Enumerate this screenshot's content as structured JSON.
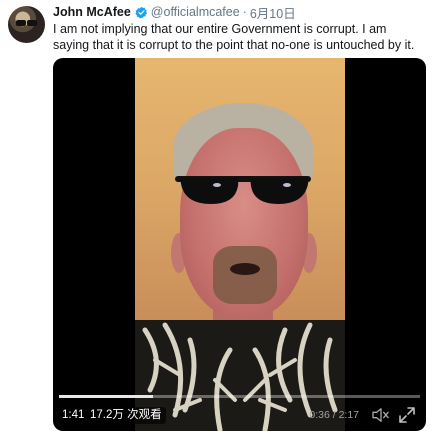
{
  "tweet": {
    "author_name": "John McAfee",
    "handle": "@officialmcafee",
    "separator": "·",
    "date": "6月10日",
    "text": "I am not implying that our entire Government is corrupt. I am saying that it is corrupt to the point that no-one is untouched by it."
  },
  "video": {
    "elapsed_badge": "1:41",
    "views_badge": "17.2万 次观看",
    "time_display": "0:36 / 2:17",
    "played_fraction": 0.26
  },
  "icons": {
    "verified": "verified-badge-icon",
    "mute": "speaker-muted-icon",
    "fullscreen": "expand-icon"
  },
  "colors": {
    "verified_blue": "#1da1f2",
    "text_primary": "#14171a",
    "text_secondary": "#657786"
  }
}
